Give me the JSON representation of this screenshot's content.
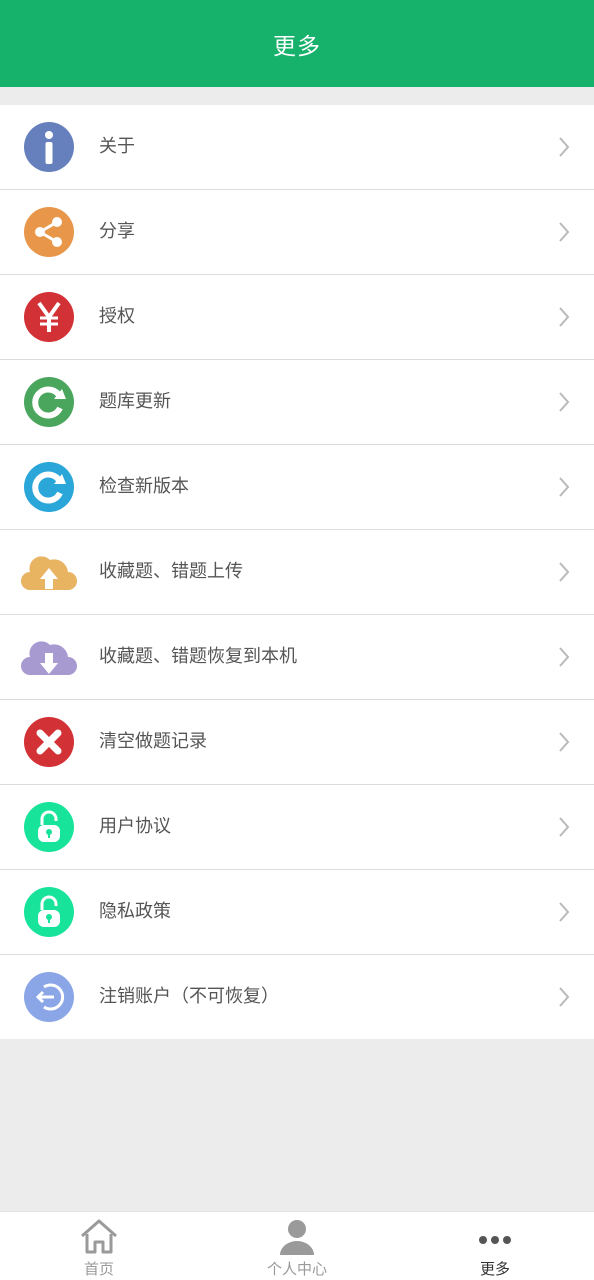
{
  "header": {
    "title": "更多"
  },
  "menu": [
    {
      "label": "关于",
      "icon": "info-icon",
      "color": "#6680bd"
    },
    {
      "label": "分享",
      "icon": "share-icon",
      "color": "#e8974a"
    },
    {
      "label": "授权",
      "icon": "yen-icon",
      "color": "#d23135"
    },
    {
      "label": "题库更新",
      "icon": "refresh-icon",
      "color": "#4aa65d"
    },
    {
      "label": "检查新版本",
      "icon": "update-icon",
      "color": "#2aa6d9"
    },
    {
      "label": "收藏题、错题上传",
      "icon": "cloud-upload-icon",
      "color": "#e8b462"
    },
    {
      "label": "收藏题、错题恢复到本机",
      "icon": "cloud-download-icon",
      "color": "#a79ad0"
    },
    {
      "label": "清空做题记录",
      "icon": "clear-icon",
      "color": "#d23135"
    },
    {
      "label": "用户协议",
      "icon": "lock-icon",
      "color": "#18e39a"
    },
    {
      "label": "隐私政策",
      "icon": "lock-icon",
      "color": "#18e39a"
    },
    {
      "label": "注销账户（不可恢复）",
      "icon": "logout-icon",
      "color": "#8aa6e6"
    }
  ],
  "tabs": [
    {
      "label": "首页",
      "icon": "home-icon",
      "active": false
    },
    {
      "label": "个人中心",
      "icon": "user-icon",
      "active": false
    },
    {
      "label": "更多",
      "icon": "more-icon",
      "active": true
    }
  ]
}
